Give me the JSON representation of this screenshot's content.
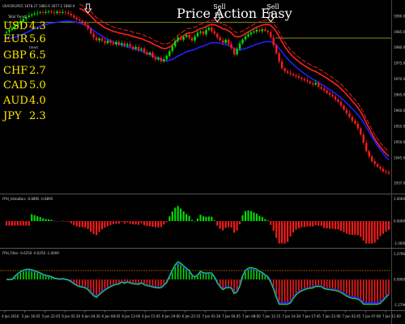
{
  "header": {
    "symbol_info": "USA500,M15  1878.27 1882.6 1877.2 1880.9",
    "title": "Price Action Easy",
    "strength_heading": "Total Trend",
    "strength_heading2": "trend"
  },
  "currency_strength": [
    {
      "ccy": "USD",
      "value": "4.3"
    },
    {
      "ccy": "EUR",
      "value": "5.6"
    },
    {
      "ccy": "GBP",
      "value": "6.5"
    },
    {
      "ccy": "CHF",
      "value": "2.7"
    },
    {
      "ccy": "CAD",
      "value": "5.0"
    },
    {
      "ccy": "AUD",
      "value": "4.0"
    },
    {
      "ccy": "JPY",
      "value": "2.3"
    }
  ],
  "sell_signals": [
    {
      "label": "Sell",
      "bar": 29
    },
    {
      "label": "Sell",
      "bar": 75
    },
    {
      "label": "Sell",
      "bar": 94
    }
  ],
  "indicator_labels": {
    "histo": "FPH_HistoBars -0.8895 -0.8895",
    "filter": "FPH_Filter -0.6250 -0.6250 -1.0009"
  },
  "colors": {
    "background": "#000000",
    "bull": "#00e000",
    "bear": "#ff1a1a",
    "ma": "#2020ff",
    "band": "#ff2020",
    "level": "#8a8a20",
    "filter_line": "#22dd22",
    "text": "#cfcfcf",
    "strength": "#ffe800"
  },
  "chart_data": [
    {
      "type": "candlestick",
      "title": "Price Action Easy",
      "ylim": [
        1935,
        1992
      ],
      "y_ticks": [
        "1990.0",
        "1985.0",
        "1980.0",
        "1975.0",
        "1970.0",
        "1965.0",
        "1960.0",
        "1955.0",
        "1950.0",
        "1945.0",
        "1937.0"
      ],
      "y_tick_values": [
        1990,
        1985,
        1980,
        1975,
        1970,
        1965,
        1960,
        1955,
        1950,
        1945,
        1937
      ],
      "x_ticks": [
        "4 Jan 2016",
        "5 Jan 16:45",
        "5 Jan 22:45",
        "6 Jan 02:30",
        "6 Jan 04:30",
        "6 Jan 08:45",
        "6 Jan 12:00",
        "6 Jan 15:45",
        "6 Jan 19:00",
        "6 Jan 22:15",
        "7 Jan 01:30",
        "7 Jan 04:45",
        "7 Jan 08:00",
        "7 Jan 11:15",
        "7 Jan 14:30",
        "7 Jan 17:45",
        "7 Jan 21:00",
        "7 Jan 02:45",
        "7 Jan 07:00",
        "7 Jan 11:00"
      ],
      "level_line": 1988,
      "level_line2": 1983,
      "close": [
        1985.0,
        1985.6,
        1986.2,
        1986.9,
        1987.7,
        1988.4,
        1989.1,
        1989.7,
        1990.2,
        1990.5,
        1990.8,
        1991.0,
        1991.2,
        1991.0,
        1991.3,
        1991.5,
        1991.2,
        1990.9,
        1991.4,
        1991.0,
        1991.3,
        1991.1,
        1990.7,
        1990.2,
        1989.5,
        1988.9,
        1988.5,
        1988.0,
        1987.2,
        1986.0,
        1984.4,
        1983.2,
        1982.3,
        1982.9,
        1982.1,
        1981.4,
        1982.2,
        1981.5,
        1981.0,
        1981.8,
        1980.9,
        1981.4,
        1980.6,
        1981.1,
        1980.3,
        1979.6,
        1980.2,
        1979.3,
        1979.7,
        1978.5,
        1977.8,
        1978.4,
        1976.9,
        1976.2,
        1976.8,
        1975.6,
        1976.3,
        1977.4,
        1978.9,
        1980.4,
        1982.1,
        1983.2,
        1982.5,
        1983.4,
        1984.0,
        1983.1,
        1982.2,
        1983.6,
        1984.7,
        1985.1,
        1984.2,
        1985.6,
        1986.3,
        1985.2,
        1984.4,
        1983.2,
        1982.3,
        1981.5,
        1982.5,
        1981.1,
        1979.8,
        1977.8,
        1979.6,
        1981.3,
        1982.6,
        1983.5,
        1984.2,
        1984.8,
        1985.1,
        1985.6,
        1985.2,
        1985.8,
        1985.3,
        1984.9,
        1983.2,
        1980.8,
        1978.2,
        1975.6,
        1973.4,
        1972.5,
        1972.0,
        1971.6,
        1971.2,
        1970.9,
        1970.4,
        1970.0,
        1969.6,
        1969.3,
        1968.7,
        1968.3,
        1968.8,
        1967.5,
        1967.0,
        1966.4,
        1965.6,
        1965.0,
        1964.5,
        1963.5,
        1962.8,
        1961.6,
        1960.3,
        1959.2,
        1958.0,
        1956.8,
        1955.9,
        1954.4,
        1952.4,
        1949.8,
        1947.2,
        1945.5,
        1944.0,
        1943.1,
        1942.2,
        1941.6,
        1940.8,
        1940.5,
        1940.1
      ]
    },
    {
      "type": "bar",
      "title": "FPH_HistoBars -0.8895 -0.8895",
      "ylim": [
        -1.05,
        1.05
      ],
      "y_ticks": [
        "1.0000",
        "0.0000",
        "-1.0000"
      ],
      "y_tick_values": [
        1,
        0,
        -1
      ]
    },
    {
      "type": "line",
      "title": "FPH_Filter -0.6250 -0.6250 -1.0009",
      "ylim": [
        -1.35,
        1.35
      ],
      "y_ticks": [
        "1.2796",
        "0.0000",
        "-1.2796"
      ],
      "y_tick_values": [
        1.2796,
        0,
        -1.2796
      ]
    }
  ]
}
